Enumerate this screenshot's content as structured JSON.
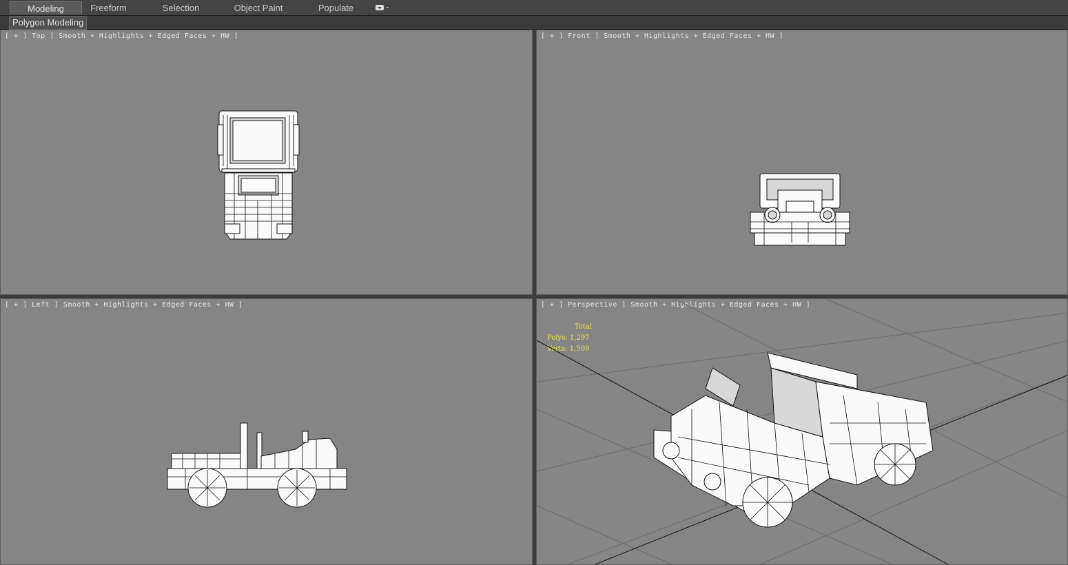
{
  "ribbon": {
    "tabs": [
      {
        "label": "Modeling",
        "active": true
      },
      {
        "label": "Freeform"
      },
      {
        "label": "Selection"
      },
      {
        "label": "Object Paint"
      },
      {
        "label": "Populate"
      }
    ],
    "sub_label": "Polygon Modeling"
  },
  "viewports": {
    "top": {
      "label": "[ + ] Top ] Smooth + Highlights + Edged Faces + HW ]"
    },
    "front": {
      "label": "[ + ] Front ] Smooth + Highlights + Edged Faces + HW ]"
    },
    "left": {
      "label": "[ + ] Left ] Smooth + Highlights + Edged Faces + HW ]"
    },
    "perspective": {
      "label": "[ + ] Perspective ] Smooth + Highlights + Edged Faces + HW ]"
    }
  },
  "stats": {
    "title": "Total",
    "polys": "Polys: 1,297",
    "verts": "Verts: 1,509"
  },
  "colors": {
    "viewport_bg": "#858585",
    "stats_text": "#f2e84a",
    "ribbon_bg": "#444444"
  }
}
